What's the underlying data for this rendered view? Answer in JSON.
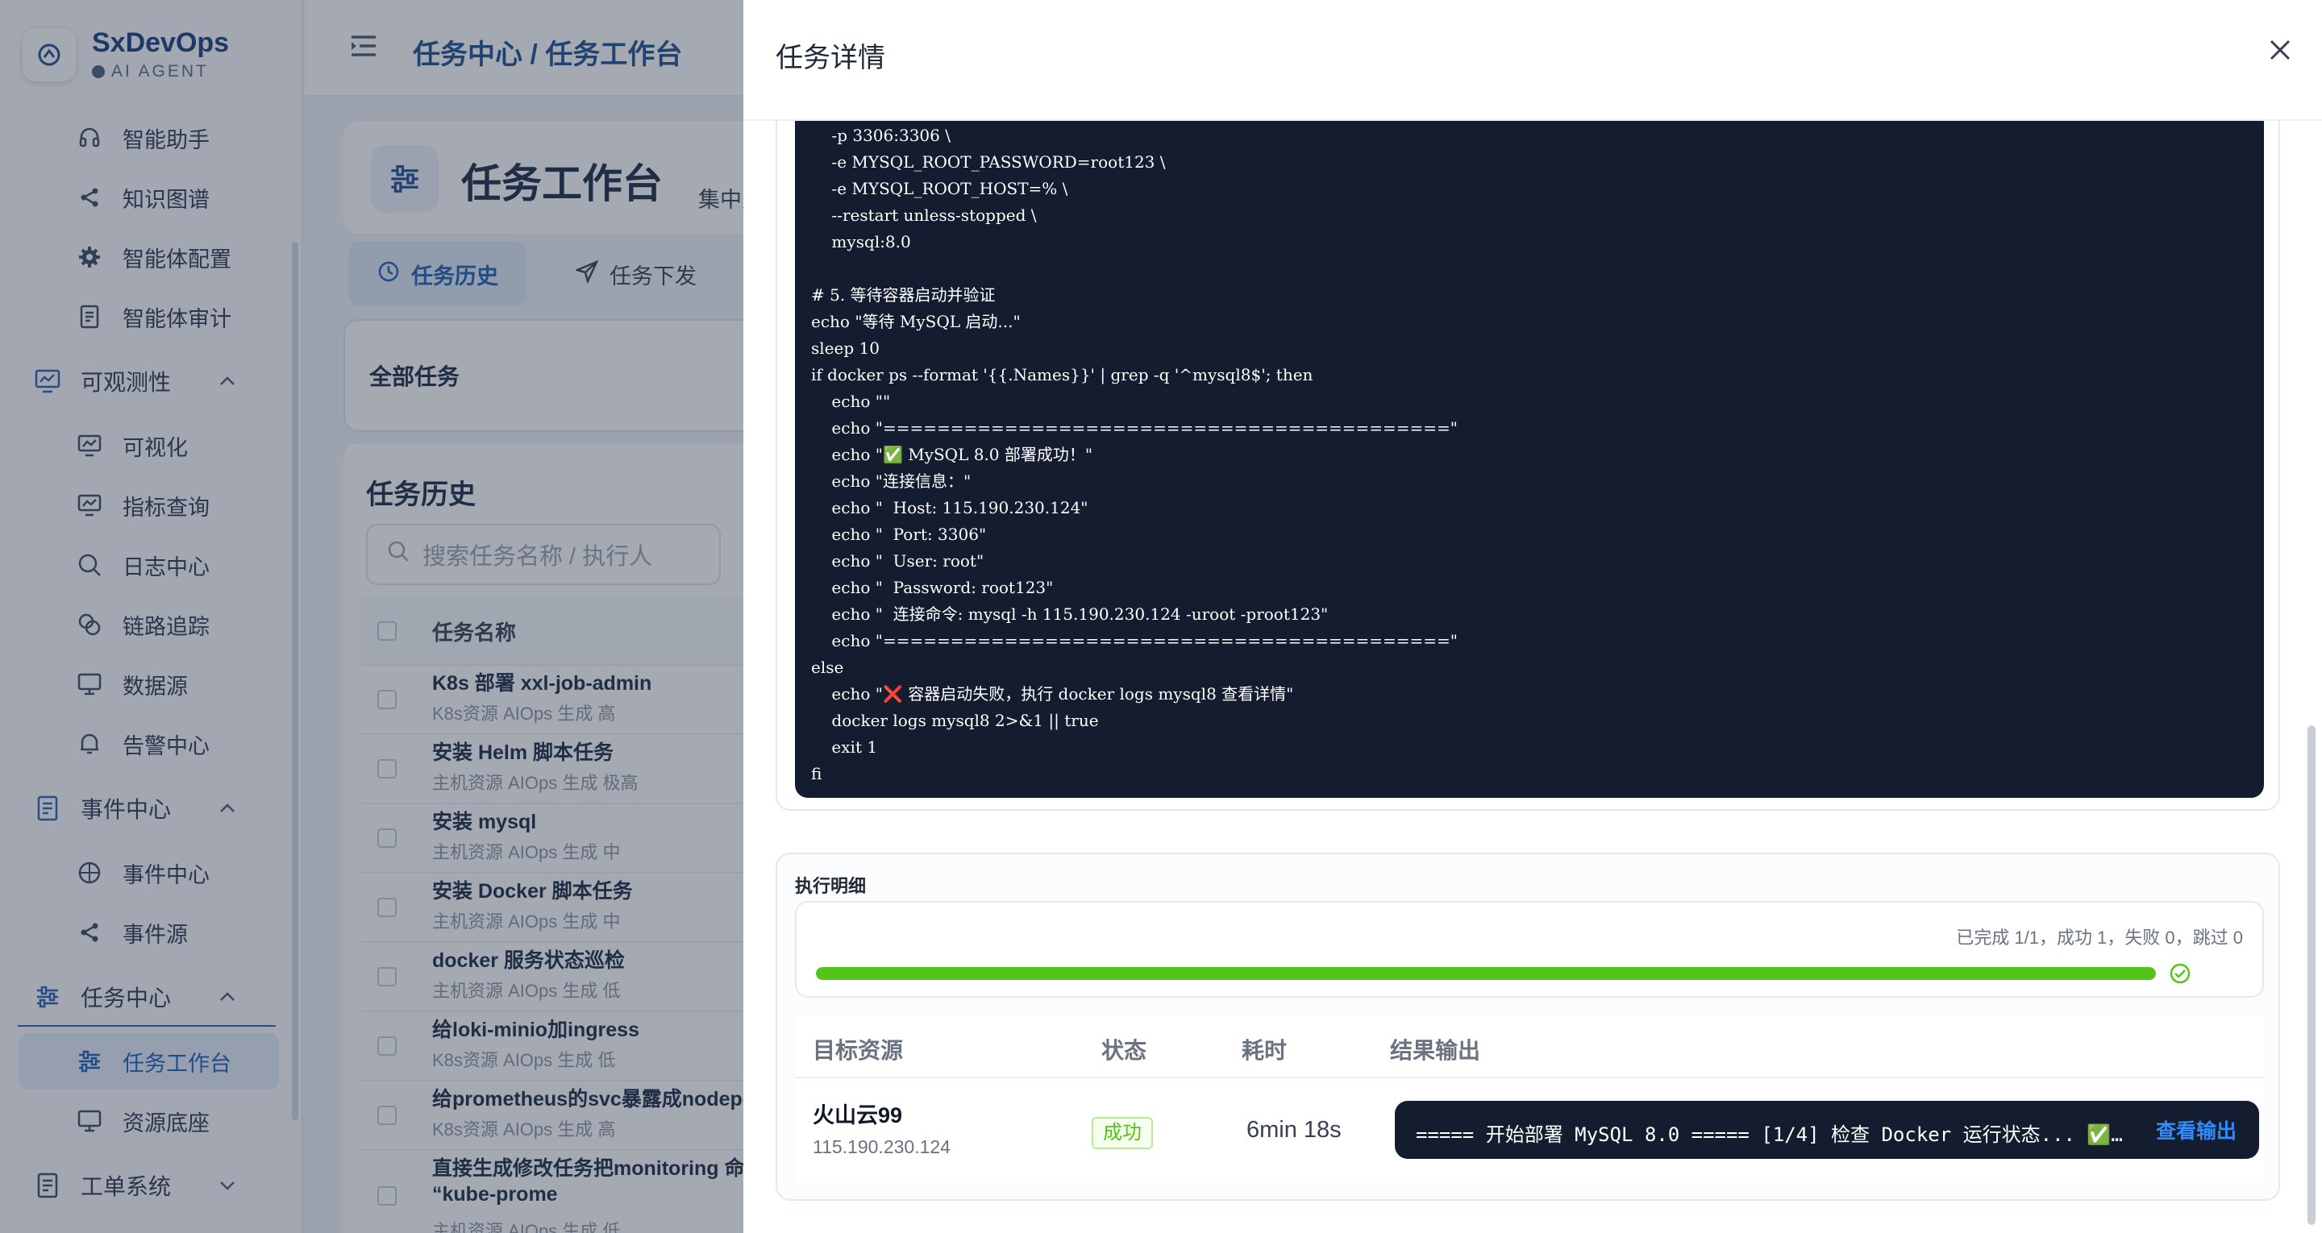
{
  "brand": {
    "name": "SxDevOps",
    "subtitle": "AI AGENT"
  },
  "sidebar": {
    "items": [
      {
        "label": "智能助手",
        "icon": "headset-icon"
      },
      {
        "label": "知识图谱",
        "icon": "share-icon"
      },
      {
        "label": "智能体配置",
        "icon": "gear-icon"
      },
      {
        "label": "智能体审计",
        "icon": "document-icon"
      }
    ],
    "groups": [
      {
        "label": "可观测性",
        "children": [
          "可视化",
          "指标查询",
          "日志中心",
          "链路追踪",
          "数据源",
          "告警中心"
        ]
      },
      {
        "label": "事件中心",
        "children": [
          "事件中心",
          "事件源"
        ]
      },
      {
        "label": "任务中心",
        "children": [
          "任务工作台",
          "资源底座"
        ]
      },
      {
        "label": "工单系统",
        "children": []
      }
    ],
    "active_item": "任务工作台"
  },
  "header": {
    "breadcrumb": "任务中心 / 任务工作台"
  },
  "page": {
    "title": "任务工作台",
    "description": "集中处理",
    "tabs": [
      {
        "label": "任务历史",
        "active": true
      },
      {
        "label": "任务下发",
        "active": false
      }
    ],
    "filter_label": "全部任务",
    "history_title": "任务历史",
    "search_placeholder": "搜索任务名称 / 执行人",
    "table_header": {
      "name": "任务名称"
    },
    "rows": [
      {
        "name": "K8s 部署 xxl-job-admin",
        "meta": "K8s资源  AIOps 生成  高"
      },
      {
        "name": "安装 Helm 脚本任务",
        "meta": "主机资源  AIOps 生成  极高"
      },
      {
        "name": "安装 mysql",
        "meta": "主机资源  AIOps 生成  中"
      },
      {
        "name": "安装 Docker 脚本任务",
        "meta": "主机资源  AIOps 生成  中"
      },
      {
        "name": "docker 服务状态巡检",
        "meta": "主机资源  AIOps 生成  低"
      },
      {
        "name": "给loki-minio加ingress",
        "meta": "K8s资源  AIOps 生成  低"
      },
      {
        "name": "给prometheus的svc暴露成nodepo",
        "meta": "K8s资源  AIOps 生成  高"
      },
      {
        "name": "直接生成修改任务把monitoring 命\n“kube-prome",
        "meta": "主机资源  AIOps 生成  低"
      }
    ]
  },
  "drawer": {
    "title": "任务详情",
    "script_lines": [
      "    -p 3306:3306 \\",
      "    -e MYSQL_ROOT_PASSWORD=root123 \\",
      "    -e MYSQL_ROOT_HOST=% \\",
      "    --restart unless-stopped \\",
      "    mysql:8.0",
      "",
      "# 5. 等待容器启动并验证",
      "echo \"等待 MySQL 启动...\"",
      "sleep 10",
      "if docker ps --format '{{.Names}}' | grep -q '^mysql8$'; then",
      "    echo \"\"",
      "    echo \"==========================================\"",
      "    echo \"✅ MySQL 8.0 部署成功！\"",
      "    echo \"连接信息：\"",
      "    echo \"  Host: 115.190.230.124\"",
      "    echo \"  Port: 3306\"",
      "    echo \"  User: root\"",
      "    echo \"  Password: root123\"",
      "    echo \"  连接命令: mysql -h 115.190.230.124 -uroot -proot123\"",
      "    echo \"==========================================\"",
      "else",
      "    echo \"❌ 容器启动失败，执行 docker logs mysql8 查看详情\"",
      "    docker logs mysql8 2>&1 || true",
      "    exit 1",
      "fi"
    ],
    "execution": {
      "title": "执行明细",
      "summary": "已完成 1/1，成功 1，失败 0，跳过 0",
      "progress": 1.0,
      "columns": [
        "目标资源",
        "状态",
        "耗时",
        "结果输出"
      ],
      "results": [
        {
          "name": "火山云99",
          "ip": "115.190.230.124",
          "status": "成功",
          "duration": "6min 18s",
          "output": "===== 开始部署 MySQL 8.0 ===== [1/4] 检查 Docker 运行状态... ✅ Docker",
          "link": "查看输出"
        }
      ]
    }
  },
  "colors": {
    "accent": "#1f5fb4",
    "success": "#52c41a",
    "code_bg": "#141c2f",
    "link": "#2f8cff"
  }
}
